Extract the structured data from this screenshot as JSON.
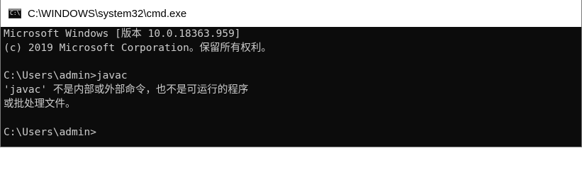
{
  "window": {
    "title": "C:\\WINDOWS\\system32\\cmd.exe",
    "icon": "cmd-icon",
    "icon_glyph": "C:\\"
  },
  "console": {
    "background_color": "#0c0c0c",
    "text_color": "#cccccc",
    "lines": [
      "Microsoft Windows [版本 10.0.18363.959]",
      "(c) 2019 Microsoft Corporation。保留所有权利。",
      "",
      "C:\\Users\\admin>javac",
      "'javac' 不是内部或外部命令，也不是可运行的程序",
      "或批处理文件。",
      "",
      "C:\\Users\\admin>"
    ]
  }
}
